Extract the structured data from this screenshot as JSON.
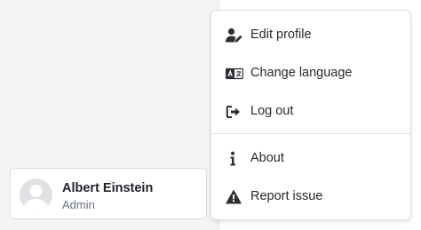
{
  "user": {
    "name": "Albert Einstein",
    "role": "Admin"
  },
  "menu": {
    "items": [
      {
        "label": "Edit profile",
        "icon": "user-edit-icon"
      },
      {
        "label": "Change language",
        "icon": "language-icon"
      },
      {
        "label": "Log out",
        "icon": "sign-out-icon"
      },
      {
        "label": "About",
        "icon": "info-icon"
      },
      {
        "label": "Report issue",
        "icon": "warning-icon"
      }
    ]
  },
  "colors": {
    "icon": "#2b2f33",
    "text": "#262a2e",
    "muted": "#6b7280",
    "border": "#d9dce0"
  }
}
